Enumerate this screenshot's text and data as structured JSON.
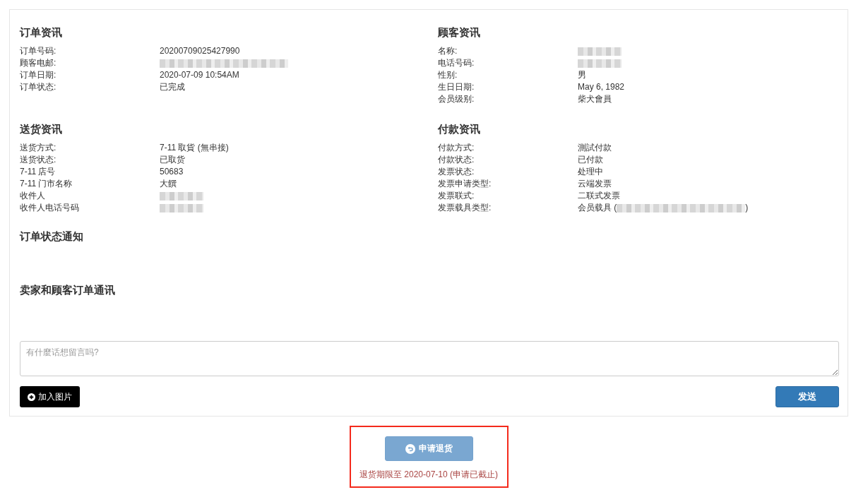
{
  "sections": [
    {
      "title": "订单资讯",
      "rows": [
        {
          "label": "订单号码:",
          "parts": [
            {
              "kind": "text",
              "text": "20200709025427990"
            }
          ]
        },
        {
          "label": "顾客电邮:",
          "parts": [
            {
              "kind": "blurred",
              "wide": true
            }
          ]
        },
        {
          "label": "订单日期:",
          "parts": [
            {
              "kind": "text",
              "text": "2020-07-09 10:54AM"
            }
          ]
        },
        {
          "label": "订单状态:",
          "parts": [
            {
              "kind": "text",
              "text": "已完成"
            }
          ]
        }
      ]
    },
    {
      "title": "顾客资讯",
      "rows": [
        {
          "label": "名称:",
          "parts": [
            {
              "kind": "blurred",
              "wide": false
            }
          ]
        },
        {
          "label": "电话号码:",
          "parts": [
            {
              "kind": "blurred",
              "wide": false
            }
          ]
        },
        {
          "label": "性别:",
          "parts": [
            {
              "kind": "text",
              "text": "男"
            }
          ]
        },
        {
          "label": "生日日期:",
          "parts": [
            {
              "kind": "text",
              "text": "May 6, 1982"
            }
          ]
        },
        {
          "label": "会员级别:",
          "parts": [
            {
              "kind": "text",
              "text": "柴犬會員"
            }
          ]
        }
      ]
    },
    {
      "title": "送货资讯",
      "rows": [
        {
          "label": "送货方式:",
          "parts": [
            {
              "kind": "text",
              "text": "7-11 取貨 (無串接)"
            }
          ]
        },
        {
          "label": "送货状态:",
          "parts": [
            {
              "kind": "text",
              "text": "已取货"
            }
          ]
        },
        {
          "label": "7-11 店号",
          "parts": [
            {
              "kind": "text",
              "text": "50683"
            }
          ]
        },
        {
          "label": "7-11 门市名称",
          "parts": [
            {
              "kind": "text",
              "text": "大饌"
            }
          ]
        },
        {
          "label": "收件人",
          "parts": [
            {
              "kind": "blurred",
              "wide": false
            }
          ]
        },
        {
          "label": "收件人电话号码",
          "parts": [
            {
              "kind": "blurred",
              "wide": false
            }
          ]
        }
      ]
    },
    {
      "title": "付款资讯",
      "rows": [
        {
          "label": "付款方式:",
          "parts": [
            {
              "kind": "text",
              "text": "測試付款"
            }
          ]
        },
        {
          "label": "付款状态:",
          "parts": [
            {
              "kind": "text",
              "text": "已付款"
            }
          ]
        },
        {
          "label": "发票状态:",
          "parts": [
            {
              "kind": "text",
              "text": "处理中"
            }
          ]
        },
        {
          "label": "发票申请类型:",
          "parts": [
            {
              "kind": "text",
              "text": "云端发票"
            }
          ]
        },
        {
          "label": "发票联式:",
          "parts": [
            {
              "kind": "text",
              "text": "二联式发票"
            }
          ]
        },
        {
          "label": "发票载具类型:",
          "parts": [
            {
              "kind": "text",
              "text": "会员载具 ("
            },
            {
              "kind": "blurred",
              "wide": true
            },
            {
              "kind": "text",
              "text": ")"
            }
          ]
        }
      ]
    }
  ],
  "notifications": {
    "title": "订单状态通知"
  },
  "messages": {
    "title": "卖家和顾客订单通讯",
    "input": {
      "placeholder": "有什麼话想留言吗?"
    },
    "add_image_button": "加入图片",
    "send_button": "发送"
  },
  "return_section": {
    "highlighted": true,
    "button": {
      "label": "申请退货",
      "disabled": true
    },
    "deadline_note": "退货期限至 2020-07-10 (申请已截止)"
  }
}
